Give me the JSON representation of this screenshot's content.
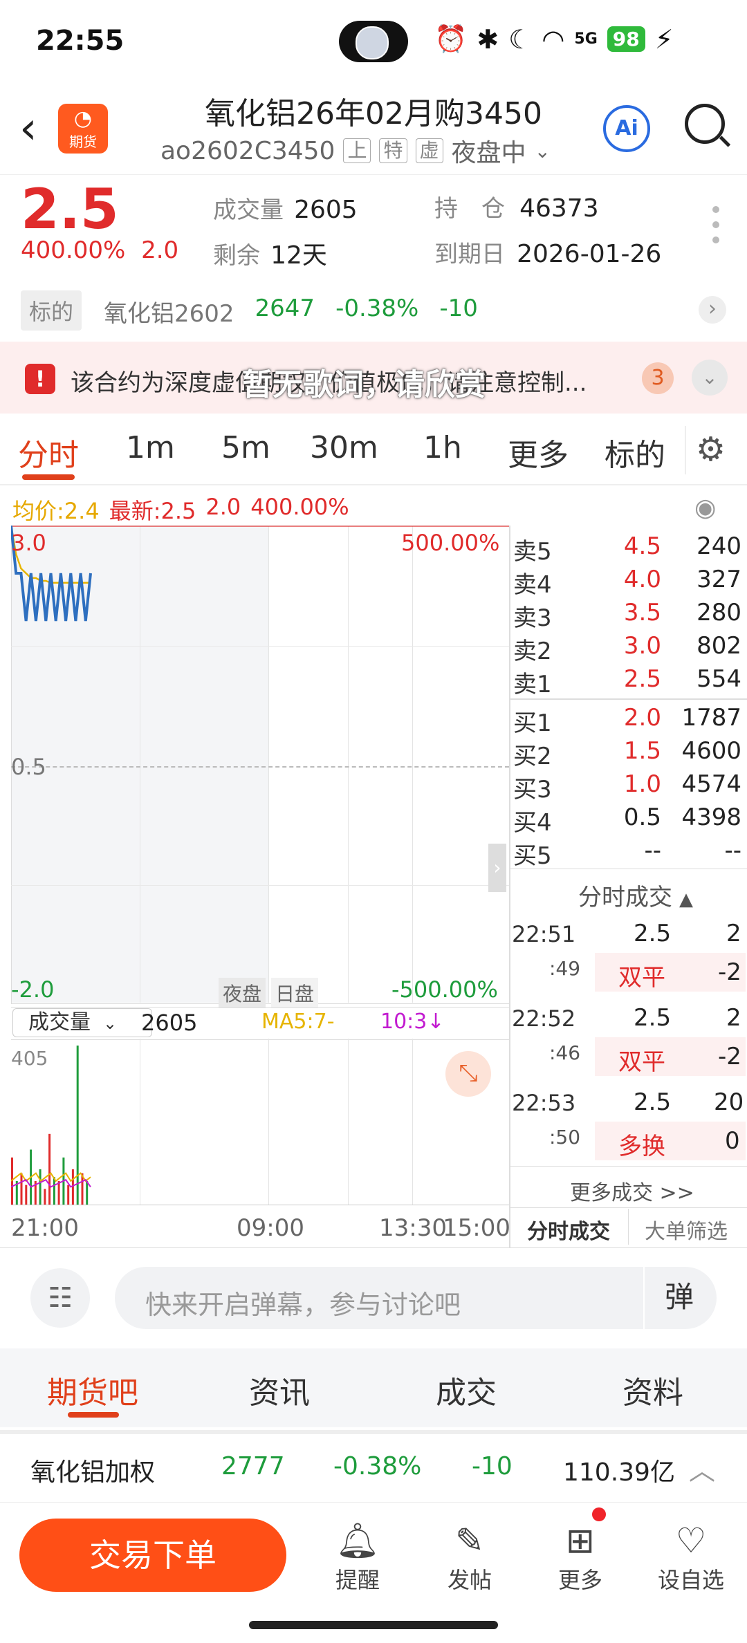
{
  "status_bar": {
    "time": "22:55",
    "battery": "98",
    "net": "5G"
  },
  "header": {
    "title": "氧化铝26年02月购3450",
    "code": "ao2602C3450",
    "tags": [
      "上",
      "特",
      "虚"
    ],
    "session": "夜盘中",
    "ai_label": "Ai",
    "logo_label": "期货"
  },
  "quote": {
    "price": "2.5",
    "change_pct": "400.00%",
    "change_abs": "2.0",
    "volume_label": "成交量",
    "volume": "2605",
    "oi_label": "持　仓",
    "oi": "46373",
    "remain_label": "剩余",
    "remain": "12天",
    "expiry_label": "到期日",
    "expiry": "2026-01-26"
  },
  "underlying": {
    "tag": "标的",
    "name": "氧化铝2602",
    "price": "2647",
    "pct": "-0.38%",
    "chg": "-10"
  },
  "warning": {
    "text": "该合约为深度虚值期权，价值极低，请注意控制...",
    "count": "3",
    "overlay": "暂无歌词，请欣赏"
  },
  "tabs": [
    "分时",
    "1m",
    "5m",
    "30m",
    "1h",
    "更多",
    "标的"
  ],
  "chart_info": {
    "avg": "均价:2.4",
    "latest": "最新:2.5",
    "chg": "2.0",
    "pct": "400.00%"
  },
  "chart": {
    "y_top": "3.0",
    "y_mid": "0.5",
    "y_bot": "-2.0",
    "pct_top": "500.00%",
    "pct_bot": "-500.00%",
    "night_tag": "夜盘",
    "day_tag": "日盘",
    "x_labels": [
      "21:00",
      "09:00",
      "13:30",
      "15:00"
    ]
  },
  "volume": {
    "selector": "成交量",
    "value": "2605",
    "ma5": "MA5:7-",
    "ma10": "10:3↓",
    "max": "405"
  },
  "chart_data": {
    "type": "line",
    "title": "",
    "xlabel": "",
    "ylabel": "",
    "ylim": [
      -2.0,
      3.0
    ],
    "x_range": [
      "21:00",
      "15:00"
    ],
    "series": [
      {
        "name": "最新",
        "values": [
          3.0,
          2.5,
          2.5,
          2.0,
          2.5,
          2.0,
          2.5,
          2.0,
          2.5,
          2.0,
          2.5,
          2.0,
          2.5,
          2.0,
          2.5,
          2.0,
          2.5
        ]
      },
      {
        "name": "均价",
        "values": [
          3.0,
          2.7,
          2.55,
          2.5,
          2.45,
          2.45,
          2.42,
          2.42,
          2.4,
          2.4,
          2.4,
          2.4,
          2.4,
          2.4,
          2.4,
          2.4,
          2.4
        ]
      }
    ],
    "volume": [
      120,
      60,
      80,
      50,
      140,
      60,
      90,
      40,
      180,
      70,
      60,
      120,
      50,
      90,
      405,
      80,
      60
    ]
  },
  "orderbook": {
    "asks": [
      {
        "label": "卖5",
        "price": "4.5",
        "vol": "240"
      },
      {
        "label": "卖4",
        "price": "4.0",
        "vol": "327"
      },
      {
        "label": "卖3",
        "price": "3.5",
        "vol": "280"
      },
      {
        "label": "卖2",
        "price": "3.0",
        "vol": "802"
      },
      {
        "label": "卖1",
        "price": "2.5",
        "vol": "554"
      }
    ],
    "bids": [
      {
        "label": "买1",
        "price": "2.0",
        "vol": "1787"
      },
      {
        "label": "买2",
        "price": "1.5",
        "vol": "4600"
      },
      {
        "label": "买3",
        "price": "1.0",
        "vol": "4574"
      },
      {
        "label": "买4",
        "price": "0.5",
        "vol": "4398"
      },
      {
        "label": "买5",
        "price": "--",
        "vol": "--"
      }
    ],
    "trades_title": "分时成交",
    "trades": [
      {
        "time": "22:51",
        "sub": ":49",
        "price": "2.5",
        "qty": "2",
        "kind": "双平",
        "oi": "-2"
      },
      {
        "time": "22:52",
        "sub": ":46",
        "price": "2.5",
        "qty": "2",
        "kind": "双平",
        "oi": "-2"
      },
      {
        "time": "22:53",
        "sub": ":50",
        "price": "2.5",
        "qty": "20",
        "kind": "多换",
        "oi": "0"
      }
    ],
    "more": "更多成交 >>",
    "btn_trades": "分时成交",
    "btn_big": "大单筛选"
  },
  "comment": {
    "placeholder": "快来开启弹幕，参与讨论吧",
    "danmu": "弹"
  },
  "bottom_tabs": [
    "期货吧",
    "资讯",
    "成交",
    "资料"
  ],
  "weighted": {
    "name": "氧化铝加权",
    "price": "2777",
    "pct": "-0.38%",
    "chg": "-10",
    "amount": "110.39亿"
  },
  "actions": {
    "trade": "交易下单",
    "remind": "提醒",
    "post": "发帖",
    "more": "更多",
    "watch": "设自选"
  }
}
